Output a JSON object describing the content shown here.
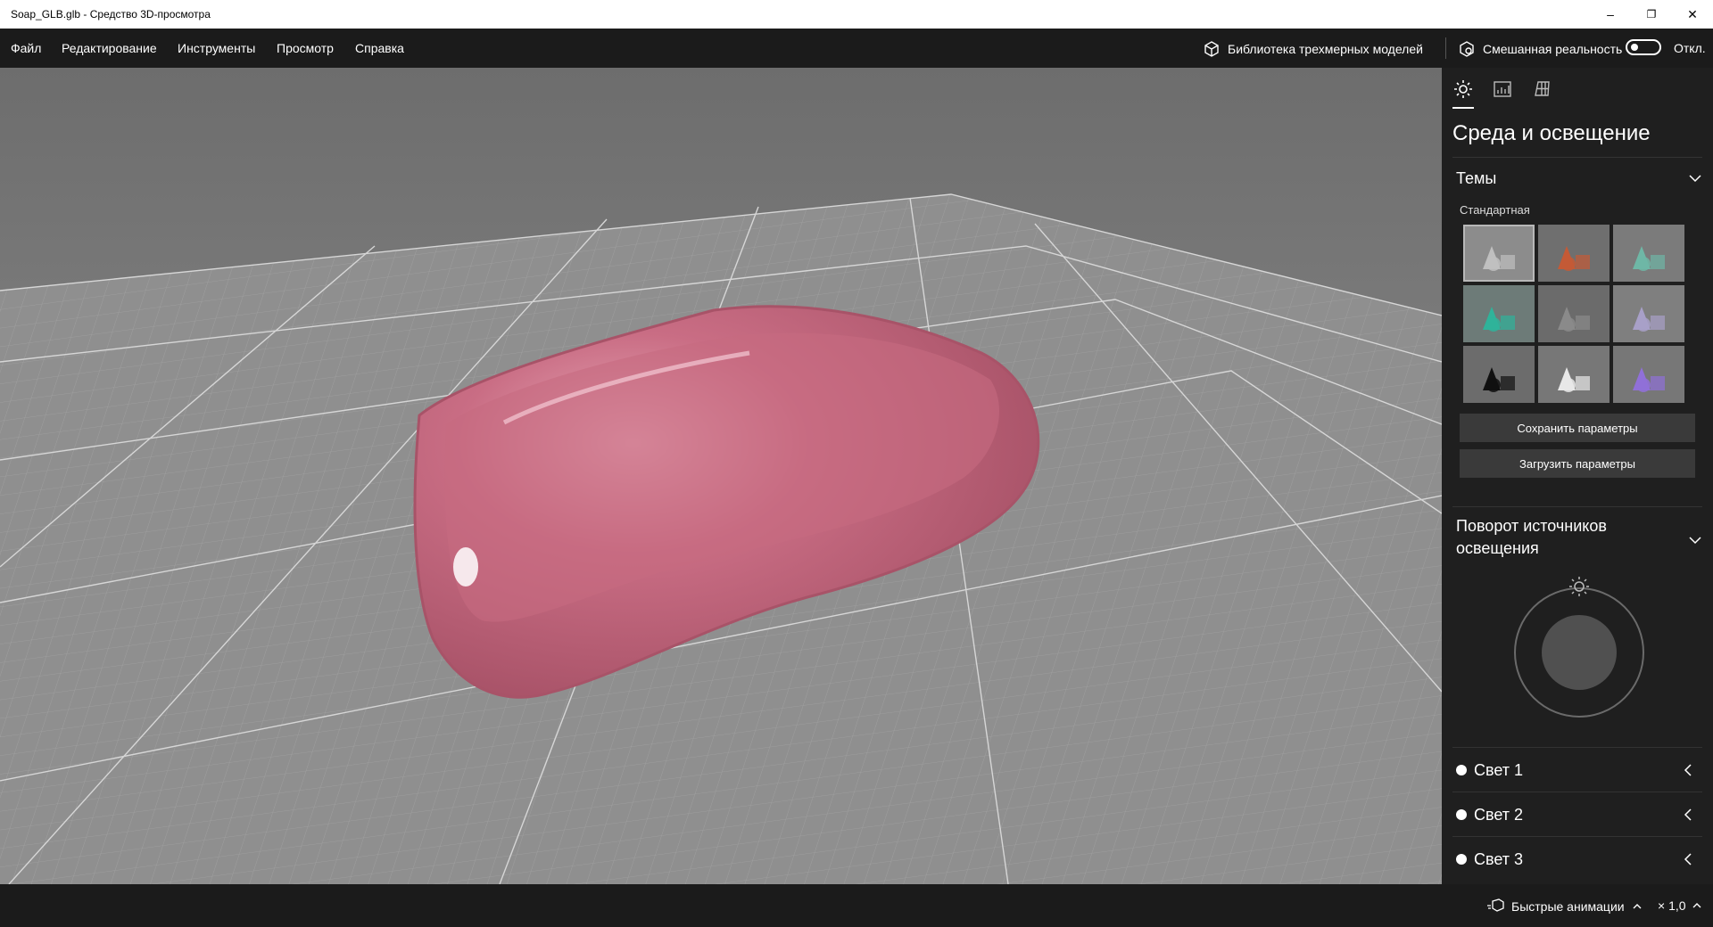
{
  "window": {
    "title": "Soap_GLB.glb - Средство 3D-просмотра",
    "minimize": "–",
    "restore": "❐",
    "close": "✕"
  },
  "menu": {
    "items": [
      "Файл",
      "Редактирование",
      "Инструменты",
      "Просмотр",
      "Справка"
    ],
    "library_label": "Библиотека трехмерных моделей",
    "mixed_reality_label": "Смешанная реальность",
    "mixed_reality_state": "Откл."
  },
  "panel": {
    "tabs": [
      "sun-icon",
      "stats-icon",
      "grid-icon"
    ],
    "title": "Среда и освещение",
    "themes": {
      "title": "Темы",
      "current": "Стандартная",
      "swatches": [
        [
          "#8c8c8c",
          "#bfbfbf"
        ],
        [
          "#6f6f6f",
          "#c45a36"
        ],
        [
          "#7b7b7b",
          "#6fb7a6"
        ],
        [
          "#6d7b78",
          "#2fb39a"
        ],
        [
          "#6b6b6b",
          "#8a8a8a"
        ],
        [
          "#7f7f7f",
          "#a8a0c8"
        ],
        [
          "#6c6c6c",
          "#111111"
        ],
        [
          "#777777",
          "#e8e8e8"
        ],
        [
          "#777777",
          "#9070d8"
        ]
      ]
    },
    "save_label": "Сохранить параметры",
    "load_label": "Загрузить параметры",
    "rotation": {
      "title_line1": "Поворот источников",
      "title_line2": "освещения"
    },
    "lights": [
      "Свет 1",
      "Свет 2",
      "Свет 3"
    ]
  },
  "bottom": {
    "animations_label": "Быстрые анимации",
    "speed": "× 1,0"
  },
  "colors": {
    "soap": "#c8687e",
    "menubar": "#1b1b1b",
    "panel": "#1f1f1f"
  }
}
